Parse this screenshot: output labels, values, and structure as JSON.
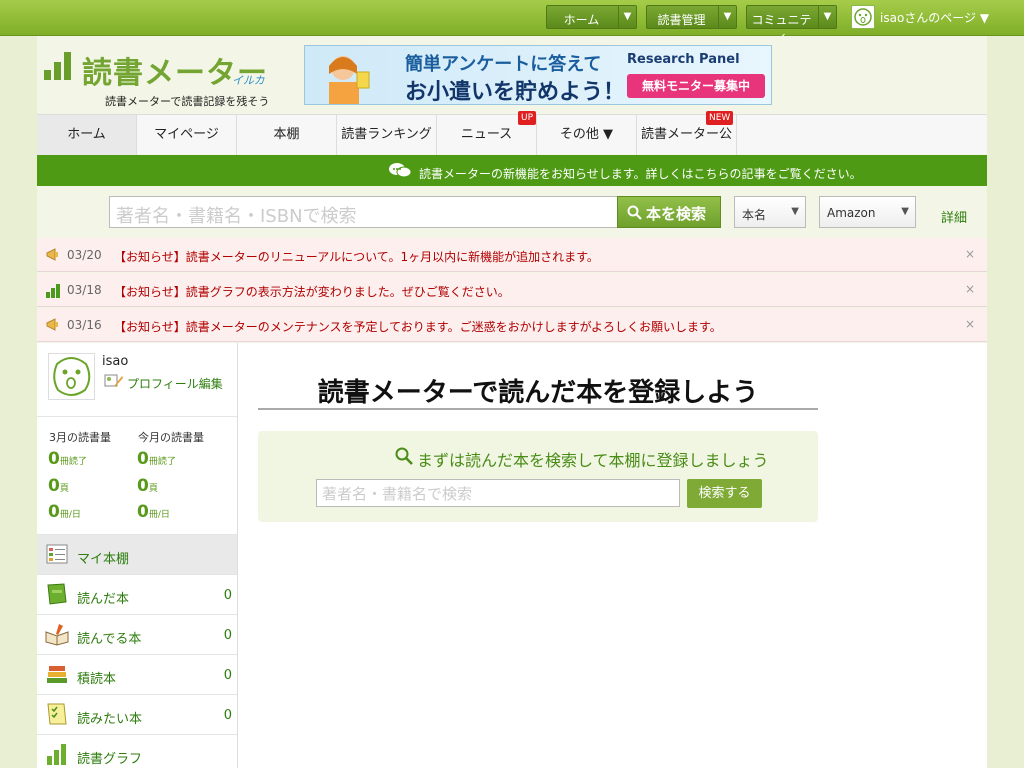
{
  "topbar": {
    "buttons": [
      {
        "label": "ホーム"
      },
      {
        "label": "読書管理"
      },
      {
        "label": "コミュニティ"
      }
    ],
    "user_label": "isaoさんのページ ▼"
  },
  "header": {
    "logo_text": "読書メーター",
    "logo_ruby": "イルカ",
    "tagline": "読書メーターで読書記録を残そう",
    "banner": {
      "line1": "簡単アンケートに答えて",
      "line2": "お小遣いを貯めよう！",
      "brand": "Research Panel",
      "cta": "無料モニター募集中"
    }
  },
  "nav": {
    "items": [
      {
        "label": "ホーム"
      },
      {
        "label": "マイページ"
      },
      {
        "label": "本棚"
      },
      {
        "label": "読書ランキング"
      },
      {
        "label": "ニュース",
        "badge": "UP"
      },
      {
        "label": "その他 ▼"
      },
      {
        "label": "読書メーター公式",
        "badge": "NEW"
      }
    ]
  },
  "notice": {
    "text": "読書メーターの新機能をお知らせします。詳しくはこちらの記事をご覧ください。"
  },
  "search": {
    "placeholder": "著者名・書籍名・ISBNで検索",
    "button_label": "本を検索",
    "category": "本名",
    "store": "Amazon",
    "link": "詳細"
  },
  "alerts": [
    {
      "date": "03/20",
      "message": "【お知らせ】読書メーターのリニューアルについて。1ヶ月以内に新機能が追加されます。"
    },
    {
      "date": "03/18",
      "message": "【お知らせ】読書グラフの表示方法が変わりました。ぜひご覧ください。"
    },
    {
      "date": "03/16",
      "message": "【お知らせ】読書メーターのメンテナンスを予定しております。ご迷惑をおかけしますがよろしくお願いします。"
    }
  ],
  "profile": {
    "name": "isao",
    "edit_label": "プロフィール編集"
  },
  "stats": {
    "col1_header": "3月の読書量",
    "col2_header": "今月の読書量",
    "col1": [
      {
        "value": "0",
        "unit": "冊読了"
      },
      {
        "value": "0",
        "unit": "頁"
      },
      {
        "value": "0",
        "unit": "冊/日"
      }
    ],
    "col2": [
      {
        "value": "0",
        "unit": "冊読了"
      },
      {
        "value": "0",
        "unit": "頁"
      },
      {
        "value": "0",
        "unit": "冊/日"
      }
    ]
  },
  "menu": [
    {
      "label": "マイ本棚",
      "count": ""
    },
    {
      "label": "読んだ本",
      "count": "0"
    },
    {
      "label": "読んでる本",
      "count": "0"
    },
    {
      "label": "積読本",
      "count": "0"
    },
    {
      "label": "読みたい本",
      "count": "0"
    },
    {
      "label": "読書グラフ",
      "count": ""
    }
  ],
  "content": {
    "title": "読書メーターで読んだ本を登録しよう",
    "box_heading": "まずは読んだ本を検索して本棚に登録しましょう",
    "input_placeholder": "著者名・書籍名で検索",
    "button_label": "検索する"
  },
  "colors": {
    "brand_green": "#7fae28",
    "notice_green": "#4e9a14",
    "link_green": "#2e7d0e",
    "alert_red": "#b10000"
  }
}
